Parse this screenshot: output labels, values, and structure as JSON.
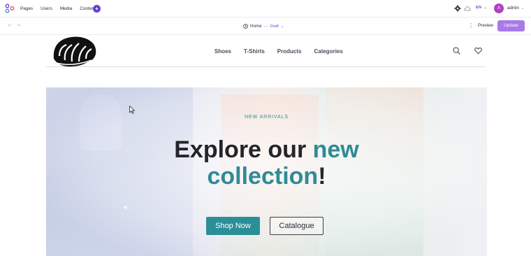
{
  "admin": {
    "nav": [
      "Pages",
      "Users",
      "Media",
      "Content"
    ],
    "plus_label": "+",
    "language": "EN",
    "avatar_initial": "A",
    "user_name": "admin",
    "accent_color": "#6a3cd4"
  },
  "editor": {
    "undo_icon": "undo-icon",
    "redo_icon": "redo-icon",
    "page_name": "Home",
    "separator": "—",
    "status": "Draft",
    "preview_label": "Preview",
    "update_label": "Update",
    "update_color": "#a879e8"
  },
  "site": {
    "nav": [
      "Shoes",
      "T-Shirts",
      "Products",
      "Categories"
    ]
  },
  "hero": {
    "eyebrow": "NEW ARRIVALS",
    "headline_part1": "Explore our ",
    "headline_accent1": "new",
    "headline_accent2": "collection",
    "headline_end": "!",
    "primary_cta": "Shop Now",
    "secondary_cta": "Catalogue",
    "accent_color": "#2e8b96"
  }
}
